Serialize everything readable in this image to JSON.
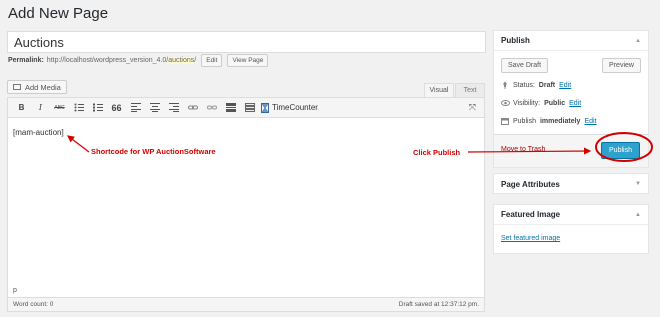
{
  "header": {
    "title": "Add New Page"
  },
  "post": {
    "title": "Auctions"
  },
  "permalink": {
    "label": "Permalink:",
    "base": "http://localhost/wordpress_version_4.0/",
    "slug": "auctions",
    "trail": "/",
    "edit_label": "Edit",
    "view_label": "View Page"
  },
  "editor": {
    "add_media_label": "Add Media",
    "tab_visual": "Visual",
    "tab_text": "Text",
    "toolbar": {
      "bold": "B",
      "italic": "I",
      "strike": "ABC",
      "quote": "66",
      "timecounter_label": "TimeCounter"
    },
    "content": "[mam-auction]",
    "path": "p",
    "word_count": "Word count: 0",
    "saved_status": "Draft saved at 12:37:12 pm."
  },
  "publish": {
    "title": "Publish",
    "save_draft": "Save Draft",
    "preview": "Preview",
    "status_label": "Status:",
    "status_value": "Draft",
    "visibility_label": "Visibility:",
    "visibility_value": "Public",
    "schedule_label": "Publish",
    "schedule_value": "immediately",
    "edit_link": "Edit",
    "trash": "Move to Trash",
    "publish_button": "Publish"
  },
  "page_attributes": {
    "title": "Page Attributes"
  },
  "featured_image": {
    "title": "Featured Image",
    "link": "Set featured image"
  },
  "annotations": {
    "shortcode": "Shortcode for WP AuctionSoftware",
    "click_publish": "Click Publish"
  },
  "colors": {
    "annotation": "#d40000",
    "publish_button": "#2ea2cc",
    "link": "#0073aa",
    "trash": "#aa0000"
  }
}
